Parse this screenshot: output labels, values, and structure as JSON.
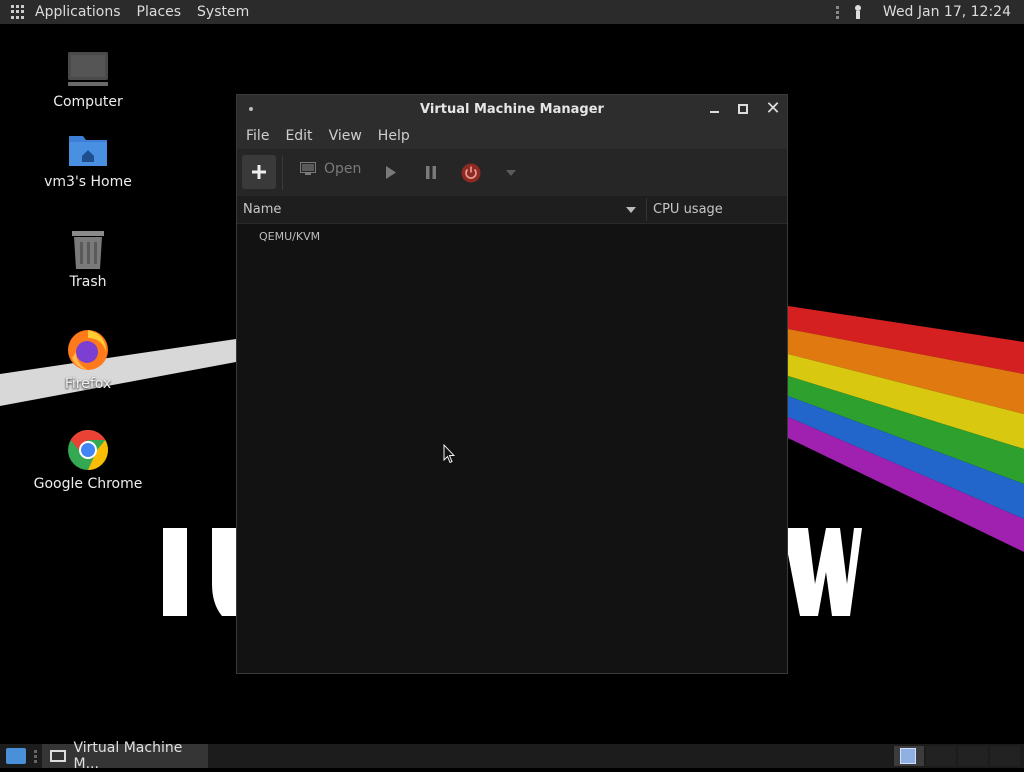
{
  "top_panel": {
    "menu": [
      "Applications",
      "Places",
      "System"
    ],
    "clock": "Wed Jan 17, 12:24"
  },
  "desktop": {
    "icons": [
      {
        "label": "Computer",
        "icon": "computer-icon"
      },
      {
        "label": "vm3's Home",
        "icon": "home-folder-icon"
      },
      {
        "label": "Trash",
        "icon": "trash-icon"
      },
      {
        "label": "Firefox",
        "icon": "firefox-icon"
      },
      {
        "label": "Google Chrome",
        "icon": "chrome-icon"
      }
    ]
  },
  "window": {
    "title": "Virtual Machine Manager",
    "menu": [
      "File",
      "Edit",
      "View",
      "Help"
    ],
    "toolbar": {
      "open_label": "Open"
    },
    "columns": {
      "name": "Name",
      "cpu": "CPU usage"
    },
    "connections": [
      "QEMU/KVM"
    ]
  },
  "taskbar": {
    "task_label": "Virtual Machine M..."
  },
  "colors": {
    "panel_bg": "#2b2b2b",
    "window_bg": "#121212",
    "shutdown_red": "#c0392b",
    "workspace_active": "#8fb0e0"
  }
}
